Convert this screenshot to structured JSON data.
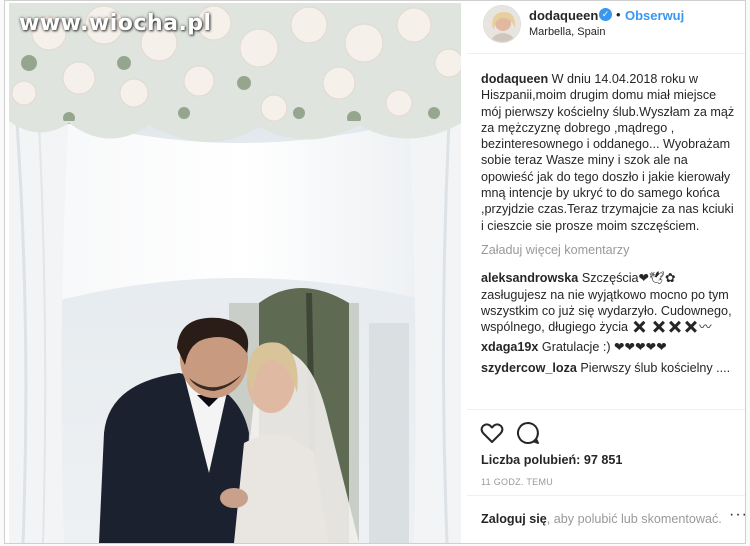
{
  "watermark": "www.wiocha.pl",
  "post": {
    "username": "dodaqueen",
    "verified_icon": "verified-badge-icon",
    "separator": "•",
    "follow_label": "Obserwuj",
    "location": "Marbella, Spain",
    "caption": "W dniu 14.04.2018 roku w Hiszpanii,moim drugim domu miał miejsce mój pierwszy kościelny ślub.Wyszłam za mąż za mężczyznę dobrego ,mądrego , bezinteresownego i oddanego... Wyobrażam sobie teraz Wasze miny i szok ale na opowieść jak do tego doszło i jakie kierowały mną intencje by ukryć to do samego końca ,przyjdzie czas.Teraz trzymajcie za nas kciuki i cieszcie sie prosze moim szczęściem."
  },
  "load_more": "Załaduj więcej komentarzy",
  "comments": [
    {
      "user": "aleksandrowska",
      "text": "Szczęścia❤︎🕊✿ zasługujesz na nie wyjątkowo mocno po tym wszystkim co już się wydarzyło. Cudownego, wspólnego, długiego życia ✖ ✖✖✖〰"
    },
    {
      "user": "xdaga19x",
      "text": "Gratulacje :) ❤❤❤❤❤"
    },
    {
      "user": "szydercow_loza",
      "text": "Pierwszy ślub kościelny ...."
    }
  ],
  "actions": {
    "like_icon": "heart-icon",
    "comment_icon": "comment-bubble-icon"
  },
  "likes_label": "Liczba polubień: 97 851",
  "time_label": "11 GODZ. TEMU",
  "footer": {
    "login_label": "Zaloguj się",
    "rest_text": ", aby polubić lub skomentować.",
    "options_icon": "more-options-icon",
    "options_glyph": "···"
  },
  "colors": {
    "link": "#3897f0",
    "muted": "#999999",
    "text": "#262626"
  }
}
